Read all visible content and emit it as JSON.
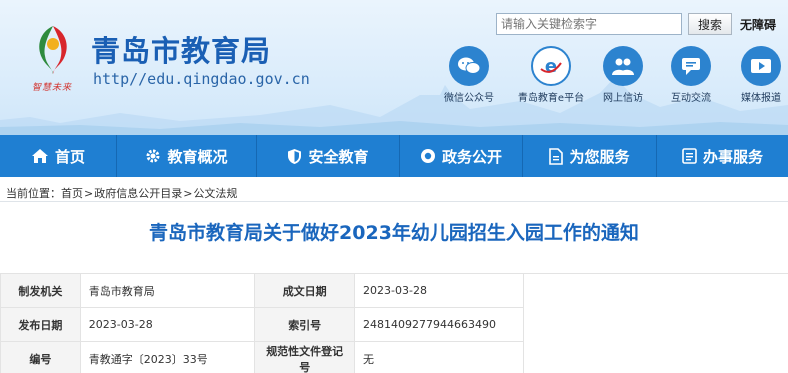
{
  "header": {
    "site_title": "青岛市教育局",
    "site_url": "http//edu.qingdao.gov.cn",
    "slogan": "智慧未来",
    "logo_icon": "qingdao-education-logo-icon"
  },
  "search": {
    "placeholder": "请输入关键检索字",
    "button_label": "搜索"
  },
  "accessibility_label": "无障碍",
  "quick_links": [
    {
      "label": "微信公众号",
      "icon": "wechat-icon"
    },
    {
      "label": "青岛教育e平台",
      "icon": "e-platform-icon"
    },
    {
      "label": "网上信访",
      "icon": "people-icon"
    },
    {
      "label": "互动交流",
      "icon": "chat-icon"
    },
    {
      "label": "媒体报道",
      "icon": "video-icon"
    }
  ],
  "nav": [
    {
      "label": "首页",
      "icon": "home-icon"
    },
    {
      "label": "教育概况",
      "icon": "gear-icon"
    },
    {
      "label": "安全教育",
      "icon": "shield-icon"
    },
    {
      "label": "政务公开",
      "icon": "record-icon"
    },
    {
      "label": "为您服务",
      "icon": "doc-icon"
    },
    {
      "label": "办事服务",
      "icon": "list-icon"
    }
  ],
  "breadcrumb": {
    "prefix": "当前位置：",
    "items": [
      "首页",
      "政府信息公开目录",
      "公文法规"
    ],
    "separator": ">"
  },
  "article": {
    "title": "青岛市教育局关于做好2023年幼儿园招生入园工作的通知"
  },
  "meta_table": [
    {
      "k1": "制发机关",
      "v1": "青岛市教育局",
      "k2": "成文日期",
      "v2": "2023-03-28"
    },
    {
      "k1": "发布日期",
      "v1": "2023-03-28",
      "k2": "索引号",
      "v2": "2481409277944663490"
    },
    {
      "k1": "编号",
      "v1": "青教通字〔2023〕33号",
      "k2": "规范性文件登记号",
      "v2": "无"
    }
  ],
  "colors": {
    "nav_bg": "#1f7fd2",
    "title_blue": "#1a66bd",
    "brand_blue": "#1a5fb4"
  }
}
